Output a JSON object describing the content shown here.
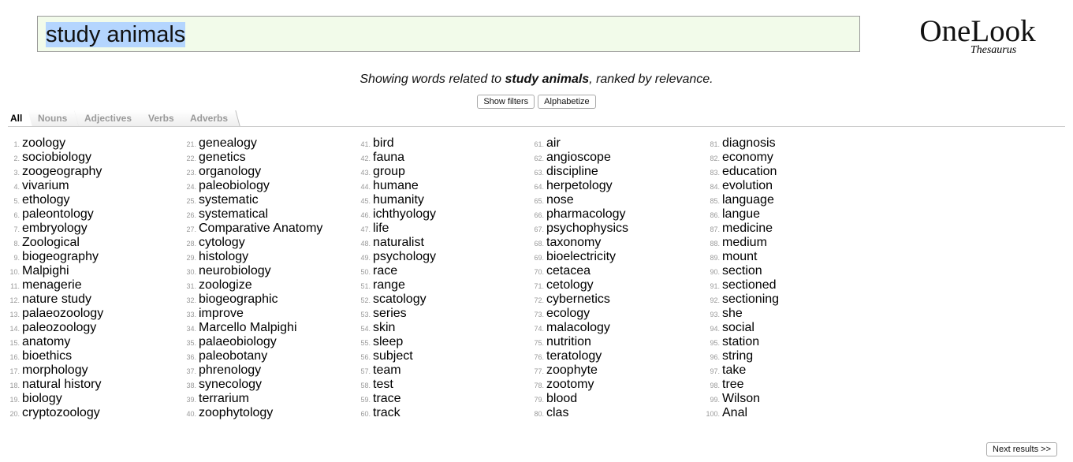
{
  "search": {
    "query": "study animals"
  },
  "logo": {
    "name": "OneLook",
    "sub": "Thesaurus"
  },
  "caption": {
    "pre": "Showing words related to ",
    "term": "study animals",
    "post": ", ranked by relevance."
  },
  "buttons": {
    "filters": "Show filters",
    "alpha": "Alphabetize",
    "next": "Next results >>"
  },
  "tabs": [
    "All",
    "Nouns",
    "Adjectives",
    "Verbs",
    "Adverbs"
  ],
  "words": [
    "zoology",
    "sociobiology",
    "zoogeography",
    "vivarium",
    "ethology",
    "paleontology",
    "embryology",
    "Zoological",
    "biogeography",
    "Malpighi",
    "menagerie",
    "nature study",
    "palaeozoology",
    "paleozoology",
    "anatomy",
    "bioethics",
    "morphology",
    "natural history",
    "biology",
    "cryptozoology",
    "genealogy",
    "genetics",
    "organology",
    "paleobiology",
    "systematic",
    "systematical",
    "Comparative Anatomy",
    "cytology",
    "histology",
    "neurobiology",
    "zoologize",
    "biogeographic",
    "improve",
    "Marcello Malpighi",
    "palaeobiology",
    "paleobotany",
    "phrenology",
    "synecology",
    "terrarium",
    "zoophytology",
    "bird",
    "fauna",
    "group",
    "humane",
    "humanity",
    "ichthyology",
    "life",
    "naturalist",
    "psychology",
    "race",
    "range",
    "scatology",
    "series",
    "skin",
    "sleep",
    "subject",
    "team",
    "test",
    "trace",
    "track",
    "air",
    "angioscope",
    "discipline",
    "herpetology",
    "nose",
    "pharmacology",
    "psychophysics",
    "taxonomy",
    "bioelectricity",
    "cetacea",
    "cetology",
    "cybernetics",
    "ecology",
    "malacology",
    "nutrition",
    "teratology",
    "zoophyte",
    "zootomy",
    "blood",
    "clas",
    "diagnosis",
    "economy",
    "education",
    "evolution",
    "language",
    "langue",
    "medicine",
    "medium",
    "mount",
    "section",
    "sectioned",
    "sectioning",
    "she",
    "social",
    "station",
    "string",
    "take",
    "tree",
    "Wilson",
    "Anal"
  ]
}
